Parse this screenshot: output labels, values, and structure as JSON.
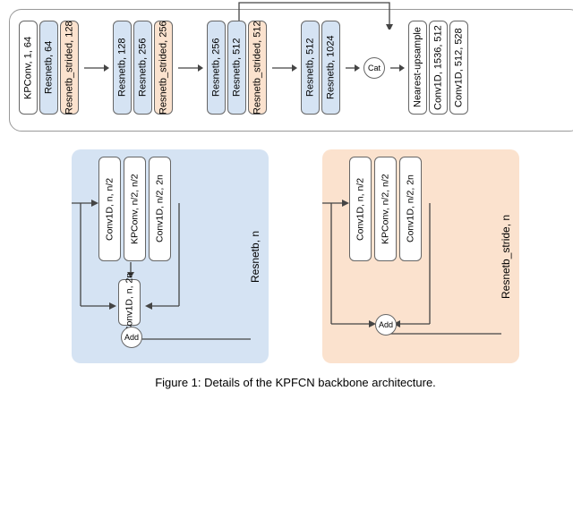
{
  "main": {
    "stage1": [
      {
        "label": "KPConv, 1, 64",
        "cls": "white"
      },
      {
        "label": "Resnetb, 64",
        "cls": "blue"
      },
      {
        "label": "Resnetb_strided, 128",
        "cls": "peach"
      }
    ],
    "stage2": [
      {
        "label": "Resnetb, 128",
        "cls": "blue"
      },
      {
        "label": "Resnetb, 256",
        "cls": "blue"
      },
      {
        "label": "Resnetb_strided, 256",
        "cls": "peach"
      }
    ],
    "stage3": [
      {
        "label": "Resnetb, 256",
        "cls": "blue"
      },
      {
        "label": "Resnetb, 512",
        "cls": "blue"
      },
      {
        "label": "Resnetb_strided, 512",
        "cls": "peach"
      }
    ],
    "stage4": [
      {
        "label": "Resnetb, 512",
        "cls": "blue"
      },
      {
        "label": "Resnetb, 1024",
        "cls": "blue"
      }
    ],
    "cat": "Cat",
    "stage5": [
      {
        "label": "Nearest-upsample",
        "cls": "white"
      },
      {
        "label": "Conv1D, 1536, 512",
        "cls": "white"
      },
      {
        "label": "Conv1D, 512, 528",
        "cls": "white"
      }
    ]
  },
  "resnetb": {
    "title": "Resnetb, n",
    "top": [
      {
        "label": "Conv1D, n, n/2"
      },
      {
        "label": "KPConv, n/2, n/2"
      },
      {
        "label": "Conv1D, n/2, 2n"
      }
    ],
    "side": "Conv1D, n, 2n",
    "merge": "Add"
  },
  "resnetb_stride": {
    "title": "Resnetb_stride, n",
    "top": [
      {
        "label": "Conv1D, n, n/2"
      },
      {
        "label": "KPConv, n/2, n/2"
      },
      {
        "label": "Conv1D, n/2, 2n"
      }
    ],
    "merge": "Add"
  },
  "caption": "Figure 1: Details of the KPFCN backbone architecture."
}
